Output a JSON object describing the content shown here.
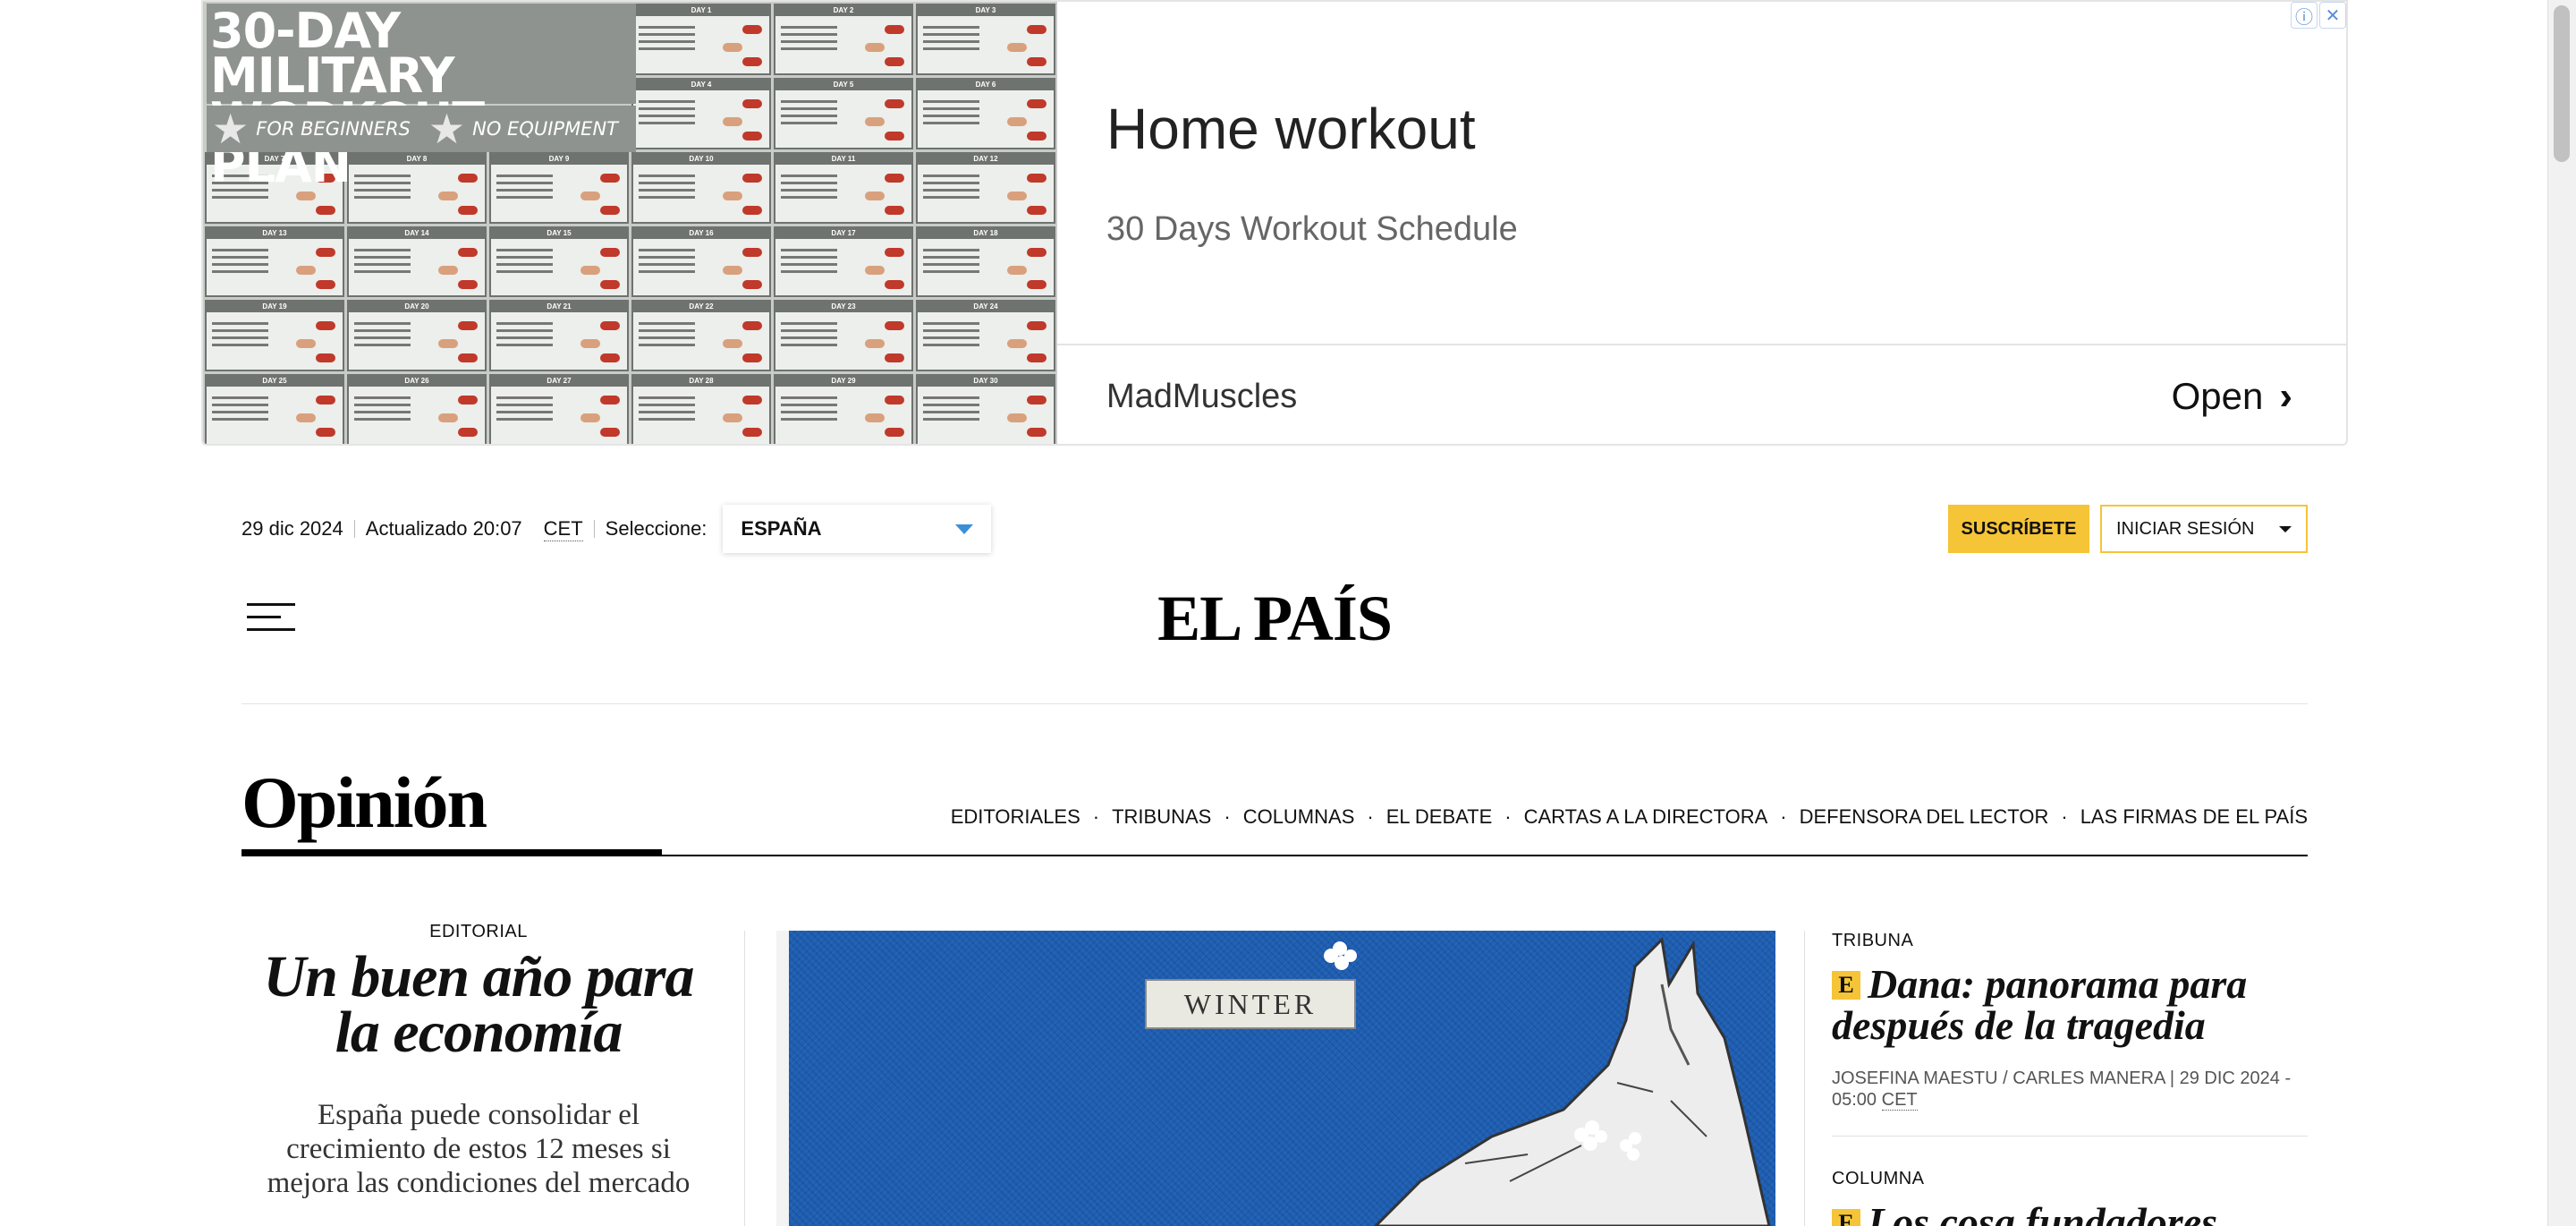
{
  "ad": {
    "image_title": "30-DAY MILITARY WORKOUT PLAN",
    "badge_1": "FOR BEGINNERS",
    "badge_2": "NO EQUIPMENT",
    "headline": "Home workout",
    "subheadline": "30 Days Workout Schedule",
    "advertiser": "MadMuscles",
    "cta": "Open",
    "info_icon": "info-icon",
    "close_icon": "close-icon"
  },
  "header": {
    "date": "29 dic 2024",
    "updated": "Actualizado 20:07",
    "timezone": "CET",
    "select_label": "Seleccione:",
    "country": "ESPAÑA",
    "subscribe": "SUSCRÍBETE",
    "login": "INICIAR SESIÓN",
    "logo": "EL PAÍS",
    "subscribe_color": "#f6c437"
  },
  "section": {
    "title": "Opinión",
    "nav": [
      "EDITORIALES",
      "TRIBUNAS",
      "COLUMNAS",
      "EL DEBATE",
      "CARTAS A LA DIRECTORA",
      "DEFENSORA DEL LECTOR",
      "LAS FIRMAS DE EL PAÍS"
    ]
  },
  "editorial": {
    "kicker": "EDITORIAL",
    "headline": "Un buen año para la economía",
    "summary": "España puede consolidar el crecimiento de estos 12 meses si mejora las condiciones del mercado"
  },
  "main_image": {
    "label": "WINTER",
    "background": "#1f5fb3"
  },
  "right_col": {
    "item1": {
      "kicker": "TRIBUNA",
      "badge": "E",
      "headline": "Dana: panorama para después de la tragedia",
      "byline": "JOSEFINA MAESTU / CARLES MANERA | 29 DIC 2024 - 05:00",
      "tz": "CET"
    },
    "item2": {
      "kicker": "COLUMNA",
      "badge": "E",
      "headline": "Los cosa fundadores"
    }
  }
}
